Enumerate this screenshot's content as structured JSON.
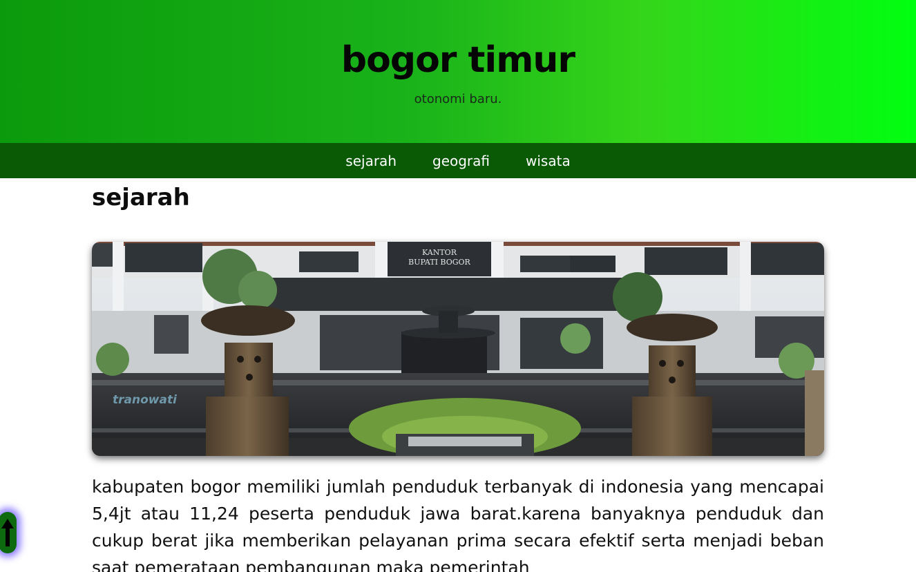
{
  "header": {
    "title": "bogor timur",
    "tagline": "otonomi baru."
  },
  "nav": {
    "items": [
      {
        "label": "sejarah"
      },
      {
        "label": "geografi"
      },
      {
        "label": "wisata"
      }
    ]
  },
  "main": {
    "section_title": "sejarah",
    "photo": {
      "sign_line1": "KANTOR",
      "sign_line2": "BUPATI BOGOR",
      "watermark": "tranowati"
    },
    "paragraph": "kabupaten bogor memiliki jumlah penduduk terbanyak di indonesia yang mencapai 5,4jt atau 11,24 peserta penduduk jawa barat.karena banyaknya penduduk dan cukup berat jika memberikan pelayanan prima secara efektif serta menjadi beban saat pemerataan pembangunan maka pemerintah"
  },
  "scroll_top": {
    "icon": "arrow-up-icon"
  },
  "colors": {
    "hero_start": "#0b9a0b",
    "hero_end": "#00ff10",
    "nav_bg": "#0a5a05",
    "scroll_glow": "#6e5aff"
  }
}
